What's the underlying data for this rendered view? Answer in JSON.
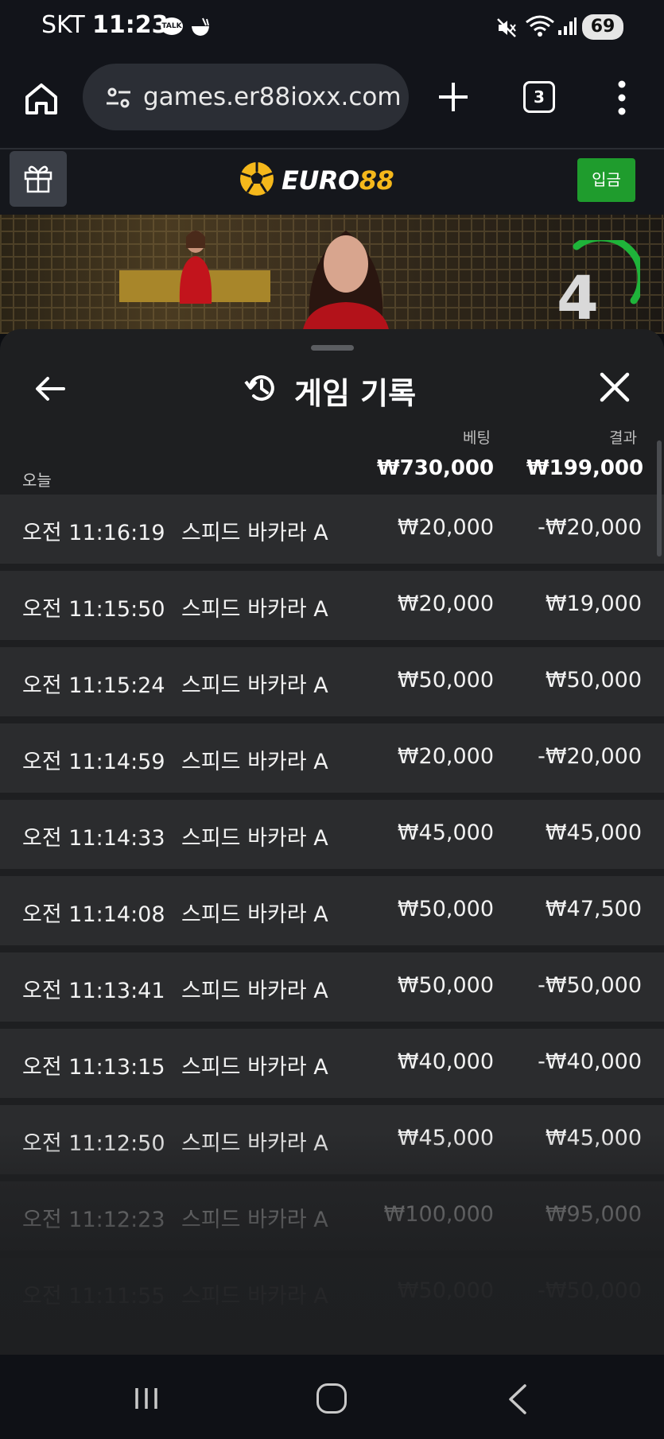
{
  "status_bar": {
    "carrier": "SKT",
    "time": "11:23",
    "talk_badge": "TALK",
    "battery": "69",
    "icons": [
      "talk-icon",
      "bowl-icon",
      "mute-icon",
      "wifi-icon",
      "signal-icon",
      "battery-icon"
    ]
  },
  "browser": {
    "url": "games.er88ioxx.com",
    "tab_count": "3",
    "icons": [
      "home-icon",
      "site-settings-icon",
      "plus-icon",
      "tabs-icon",
      "more-vert-icon"
    ]
  },
  "site": {
    "logo_word": "EURO",
    "logo_num": "88",
    "login_label": "입금",
    "gift_icon": "gift-icon",
    "accent": "#f5b81b",
    "button_color": "#1f9c2d"
  },
  "video": {
    "countdown": "4",
    "timer_color": "#1fb43a"
  },
  "panel": {
    "title": "게임 기록",
    "date_label": "오늘",
    "bet_header": "베팅",
    "result_header": "결과",
    "bet_total": "₩730,000",
    "result_total": "₩199,000",
    "rows": [
      {
        "time": "오전 11:16:19",
        "game": "스피드 바카라 A",
        "bet": "₩20,000",
        "result": "-₩20,000"
      },
      {
        "time": "오전 11:15:50",
        "game": "스피드 바카라 A",
        "bet": "₩20,000",
        "result": "₩19,000"
      },
      {
        "time": "오전 11:15:24",
        "game": "스피드 바카라 A",
        "bet": "₩50,000",
        "result": "₩50,000"
      },
      {
        "time": "오전 11:14:59",
        "game": "스피드 바카라 A",
        "bet": "₩20,000",
        "result": "-₩20,000"
      },
      {
        "time": "오전 11:14:33",
        "game": "스피드 바카라 A",
        "bet": "₩45,000",
        "result": "₩45,000"
      },
      {
        "time": "오전 11:14:08",
        "game": "스피드 바카라 A",
        "bet": "₩50,000",
        "result": "₩47,500"
      },
      {
        "time": "오전 11:13:41",
        "game": "스피드 바카라 A",
        "bet": "₩50,000",
        "result": "-₩50,000"
      },
      {
        "time": "오전 11:13:15",
        "game": "스피드 바카라 A",
        "bet": "₩40,000",
        "result": "-₩40,000"
      },
      {
        "time": "오전 11:12:50",
        "game": "스피드 바카라 A",
        "bet": "₩45,000",
        "result": "₩45,000"
      },
      {
        "time": "오전 11:12:23",
        "game": "스피드 바카라 A",
        "bet": "₩100,000",
        "result": "₩95,000"
      },
      {
        "time": "오전 11:11:55",
        "game": "스피드 바카라 A",
        "bet": "₩50,000",
        "result": "-₩50,000"
      }
    ]
  },
  "nav_bar": {
    "icons": [
      "recent-apps-icon",
      "home-circle-icon",
      "back-chevron-icon"
    ]
  }
}
